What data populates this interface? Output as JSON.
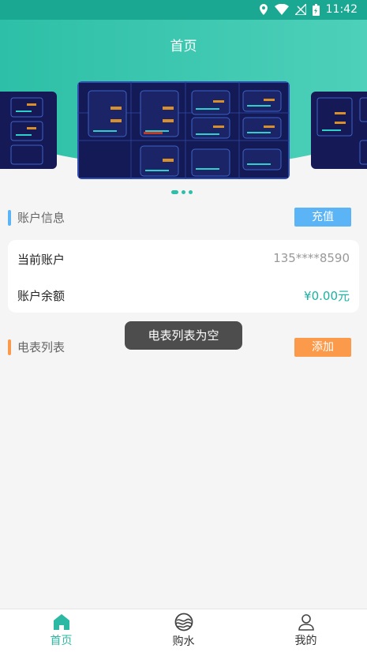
{
  "status_bar": {
    "time": "11:42",
    "icons": [
      "location-icon",
      "wifi-icon",
      "signal-icon",
      "battery-icon"
    ]
  },
  "header": {
    "title": "首页"
  },
  "banner": {
    "slides": 3,
    "active_index": 0
  },
  "account_section": {
    "title": "账户信息",
    "action_label": "充值"
  },
  "account_card": {
    "current_account_label": "当前账户",
    "current_account_value": "135****8590",
    "balance_label": "账户余额",
    "balance_value": "¥0.00元"
  },
  "meter_section": {
    "title": "电表列表",
    "action_label": "添加"
  },
  "toast": {
    "message": "电表列表为空"
  },
  "tabs": [
    {
      "label": "首页",
      "icon": "home-icon",
      "active": true
    },
    {
      "label": "购水",
      "icon": "water-icon",
      "active": false
    },
    {
      "label": "我的",
      "icon": "user-icon",
      "active": false
    }
  ],
  "colors": {
    "accent": "#2cb9a3",
    "recharge": "#5ab4f5",
    "add": "#fb9a4a",
    "amount": "#19b3a0"
  }
}
